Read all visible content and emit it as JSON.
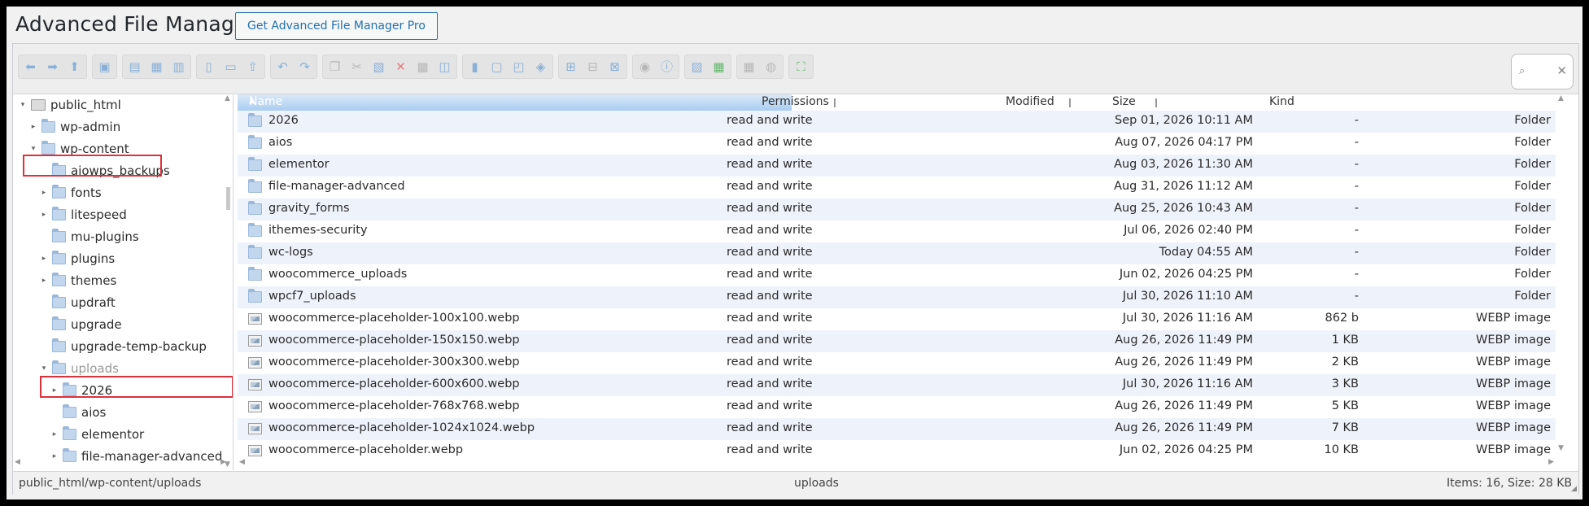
{
  "app": {
    "title": "Advanced File Manager",
    "pro_button": "Get Advanced File Manager Pro"
  },
  "toolbar": {
    "search_icon": "search-icon",
    "clear_icon": "close-icon",
    "groups": [
      [
        "back-icon",
        "forward-icon",
        "up-icon"
      ],
      [
        "home-icon"
      ],
      [
        "reload-icon",
        "new-file-icon",
        "save-icon"
      ],
      [
        "open-icon",
        "download-icon",
        "upload-icon"
      ],
      [
        "undo-icon",
        "redo-icon"
      ],
      [
        "copy-icon",
        "cut-icon",
        "paste-icon",
        "delete-icon",
        "empty-icon",
        "duplicate-icon"
      ],
      [
        "rename-icon",
        "edit-icon",
        "resize-icon",
        "extract-icon"
      ],
      [
        "list-view-icon",
        "grid-view-icon",
        "sort-icon"
      ],
      [
        "preview-icon",
        "info-icon"
      ],
      [
        "archive-icon",
        "restore-icon"
      ],
      [
        "select-all-icon",
        "help-icon"
      ],
      [
        "fullscreen-icon"
      ]
    ]
  },
  "tree": {
    "items": [
      {
        "label": "public_html",
        "depth": 0,
        "arrow": "open",
        "icon": "drive"
      },
      {
        "label": "wp-admin",
        "depth": 1,
        "arrow": "closed",
        "icon": "folder"
      },
      {
        "label": "wp-content",
        "depth": 1,
        "arrow": "open",
        "icon": "folder"
      },
      {
        "label": "aiowps_backups",
        "depth": 2,
        "arrow": "none",
        "icon": "folder"
      },
      {
        "label": "fonts",
        "depth": 2,
        "arrow": "closed",
        "icon": "folder"
      },
      {
        "label": "litespeed",
        "depth": 2,
        "arrow": "closed",
        "icon": "folder"
      },
      {
        "label": "mu-plugins",
        "depth": 2,
        "arrow": "none",
        "icon": "folder"
      },
      {
        "label": "plugins",
        "depth": 2,
        "arrow": "closed",
        "icon": "folder"
      },
      {
        "label": "themes",
        "depth": 2,
        "arrow": "closed",
        "icon": "folder"
      },
      {
        "label": "updraft",
        "depth": 2,
        "arrow": "none",
        "icon": "folder"
      },
      {
        "label": "upgrade",
        "depth": 2,
        "arrow": "none",
        "icon": "folder"
      },
      {
        "label": "upgrade-temp-backup",
        "depth": 2,
        "arrow": "none",
        "icon": "folder"
      },
      {
        "label": "uploads",
        "depth": 2,
        "arrow": "open",
        "icon": "folder",
        "dim": true
      },
      {
        "label": "2026",
        "depth": 3,
        "arrow": "closed",
        "icon": "folder"
      },
      {
        "label": "aios",
        "depth": 3,
        "arrow": "none",
        "icon": "folder"
      },
      {
        "label": "elementor",
        "depth": 3,
        "arrow": "closed",
        "icon": "folder"
      },
      {
        "label": "file-manager-advanced",
        "depth": 3,
        "arrow": "closed",
        "icon": "folder"
      }
    ]
  },
  "list": {
    "headers": {
      "name": "Name",
      "permissions": "Permissions",
      "modified": "Modified",
      "size": "Size",
      "kind": "Kind"
    },
    "rows": [
      {
        "name": "2026",
        "perm": "read and write",
        "modified": "Sep 01, 2026 10:11 AM",
        "size": "-",
        "kind": "Folder",
        "type": "folder"
      },
      {
        "name": "aios",
        "perm": "read and write",
        "modified": "Aug 07, 2026 04:17 PM",
        "size": "-",
        "kind": "Folder",
        "type": "folder"
      },
      {
        "name": "elementor",
        "perm": "read and write",
        "modified": "Aug 03, 2026 11:30 AM",
        "size": "-",
        "kind": "Folder",
        "type": "folder"
      },
      {
        "name": "file-manager-advanced",
        "perm": "read and write",
        "modified": "Aug 31, 2026 11:12 AM",
        "size": "-",
        "kind": "Folder",
        "type": "folder"
      },
      {
        "name": "gravity_forms",
        "perm": "read and write",
        "modified": "Aug 25, 2026 10:43 AM",
        "size": "-",
        "kind": "Folder",
        "type": "folder"
      },
      {
        "name": "ithemes-security",
        "perm": "read and write",
        "modified": "Jul 06, 2026 02:40 PM",
        "size": "-",
        "kind": "Folder",
        "type": "folder"
      },
      {
        "name": "wc-logs",
        "perm": "read and write",
        "modified": "Today 04:55 AM",
        "size": "-",
        "kind": "Folder",
        "type": "folder"
      },
      {
        "name": "woocommerce_uploads",
        "perm": "read and write",
        "modified": "Jun 02, 2026 04:25 PM",
        "size": "-",
        "kind": "Folder",
        "type": "folder"
      },
      {
        "name": "wpcf7_uploads",
        "perm": "read and write",
        "modified": "Jul 30, 2026 11:10 AM",
        "size": "-",
        "kind": "Folder",
        "type": "folder"
      },
      {
        "name": "woocommerce-placeholder-100x100.webp",
        "perm": "read and write",
        "modified": "Jul 30, 2026 11:16 AM",
        "size": "862 b",
        "kind": "WEBP image",
        "type": "image"
      },
      {
        "name": "woocommerce-placeholder-150x150.webp",
        "perm": "read and write",
        "modified": "Aug 26, 2026 11:49 PM",
        "size": "1 KB",
        "kind": "WEBP image",
        "type": "image"
      },
      {
        "name": "woocommerce-placeholder-300x300.webp",
        "perm": "read and write",
        "modified": "Aug 26, 2026 11:49 PM",
        "size": "2 KB",
        "kind": "WEBP image",
        "type": "image"
      },
      {
        "name": "woocommerce-placeholder-600x600.webp",
        "perm": "read and write",
        "modified": "Jul 30, 2026 11:16 AM",
        "size": "3 KB",
        "kind": "WEBP image",
        "type": "image"
      },
      {
        "name": "woocommerce-placeholder-768x768.webp",
        "perm": "read and write",
        "modified": "Aug 26, 2026 11:49 PM",
        "size": "5 KB",
        "kind": "WEBP image",
        "type": "image"
      },
      {
        "name": "woocommerce-placeholder-1024x1024.webp",
        "perm": "read and write",
        "modified": "Aug 26, 2026 11:49 PM",
        "size": "7 KB",
        "kind": "WEBP image",
        "type": "image"
      },
      {
        "name": "woocommerce-placeholder.webp",
        "perm": "read and write",
        "modified": "Jun 02, 2026 04:25 PM",
        "size": "10 KB",
        "kind": "WEBP image",
        "type": "image"
      }
    ]
  },
  "status": {
    "path": "public_html/wp-content/uploads",
    "current": "uploads",
    "summary": "Items: 16, Size: 28 KB"
  }
}
